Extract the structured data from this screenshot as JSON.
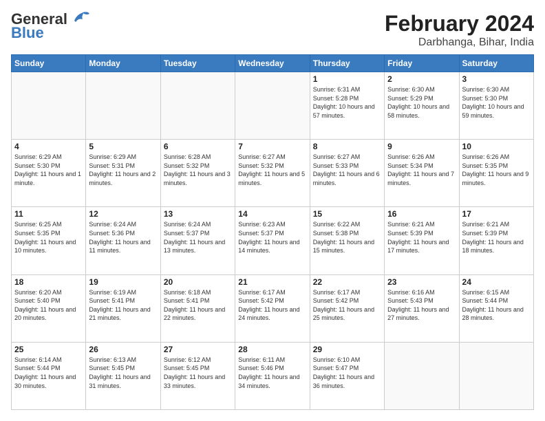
{
  "header": {
    "logo_line1": "General",
    "logo_line2": "Blue",
    "title": "February 2024",
    "subtitle": "Darbhanga, Bihar, India"
  },
  "weekdays": [
    "Sunday",
    "Monday",
    "Tuesday",
    "Wednesday",
    "Thursday",
    "Friday",
    "Saturday"
  ],
  "weeks": [
    [
      {
        "day": "",
        "info": ""
      },
      {
        "day": "",
        "info": ""
      },
      {
        "day": "",
        "info": ""
      },
      {
        "day": "",
        "info": ""
      },
      {
        "day": "1",
        "info": "Sunrise: 6:31 AM\nSunset: 5:28 PM\nDaylight: 10 hours and 57 minutes."
      },
      {
        "day": "2",
        "info": "Sunrise: 6:30 AM\nSunset: 5:29 PM\nDaylight: 10 hours and 58 minutes."
      },
      {
        "day": "3",
        "info": "Sunrise: 6:30 AM\nSunset: 5:30 PM\nDaylight: 10 hours and 59 minutes."
      }
    ],
    [
      {
        "day": "4",
        "info": "Sunrise: 6:29 AM\nSunset: 5:30 PM\nDaylight: 11 hours and 1 minute."
      },
      {
        "day": "5",
        "info": "Sunrise: 6:29 AM\nSunset: 5:31 PM\nDaylight: 11 hours and 2 minutes."
      },
      {
        "day": "6",
        "info": "Sunrise: 6:28 AM\nSunset: 5:32 PM\nDaylight: 11 hours and 3 minutes."
      },
      {
        "day": "7",
        "info": "Sunrise: 6:27 AM\nSunset: 5:32 PM\nDaylight: 11 hours and 5 minutes."
      },
      {
        "day": "8",
        "info": "Sunrise: 6:27 AM\nSunset: 5:33 PM\nDaylight: 11 hours and 6 minutes."
      },
      {
        "day": "9",
        "info": "Sunrise: 6:26 AM\nSunset: 5:34 PM\nDaylight: 11 hours and 7 minutes."
      },
      {
        "day": "10",
        "info": "Sunrise: 6:26 AM\nSunset: 5:35 PM\nDaylight: 11 hours and 9 minutes."
      }
    ],
    [
      {
        "day": "11",
        "info": "Sunrise: 6:25 AM\nSunset: 5:35 PM\nDaylight: 11 hours and 10 minutes."
      },
      {
        "day": "12",
        "info": "Sunrise: 6:24 AM\nSunset: 5:36 PM\nDaylight: 11 hours and 11 minutes."
      },
      {
        "day": "13",
        "info": "Sunrise: 6:24 AM\nSunset: 5:37 PM\nDaylight: 11 hours and 13 minutes."
      },
      {
        "day": "14",
        "info": "Sunrise: 6:23 AM\nSunset: 5:37 PM\nDaylight: 11 hours and 14 minutes."
      },
      {
        "day": "15",
        "info": "Sunrise: 6:22 AM\nSunset: 5:38 PM\nDaylight: 11 hours and 15 minutes."
      },
      {
        "day": "16",
        "info": "Sunrise: 6:21 AM\nSunset: 5:39 PM\nDaylight: 11 hours and 17 minutes."
      },
      {
        "day": "17",
        "info": "Sunrise: 6:21 AM\nSunset: 5:39 PM\nDaylight: 11 hours and 18 minutes."
      }
    ],
    [
      {
        "day": "18",
        "info": "Sunrise: 6:20 AM\nSunset: 5:40 PM\nDaylight: 11 hours and 20 minutes."
      },
      {
        "day": "19",
        "info": "Sunrise: 6:19 AM\nSunset: 5:41 PM\nDaylight: 11 hours and 21 minutes."
      },
      {
        "day": "20",
        "info": "Sunrise: 6:18 AM\nSunset: 5:41 PM\nDaylight: 11 hours and 22 minutes."
      },
      {
        "day": "21",
        "info": "Sunrise: 6:17 AM\nSunset: 5:42 PM\nDaylight: 11 hours and 24 minutes."
      },
      {
        "day": "22",
        "info": "Sunrise: 6:17 AM\nSunset: 5:42 PM\nDaylight: 11 hours and 25 minutes."
      },
      {
        "day": "23",
        "info": "Sunrise: 6:16 AM\nSunset: 5:43 PM\nDaylight: 11 hours and 27 minutes."
      },
      {
        "day": "24",
        "info": "Sunrise: 6:15 AM\nSunset: 5:44 PM\nDaylight: 11 hours and 28 minutes."
      }
    ],
    [
      {
        "day": "25",
        "info": "Sunrise: 6:14 AM\nSunset: 5:44 PM\nDaylight: 11 hours and 30 minutes."
      },
      {
        "day": "26",
        "info": "Sunrise: 6:13 AM\nSunset: 5:45 PM\nDaylight: 11 hours and 31 minutes."
      },
      {
        "day": "27",
        "info": "Sunrise: 6:12 AM\nSunset: 5:45 PM\nDaylight: 11 hours and 33 minutes."
      },
      {
        "day": "28",
        "info": "Sunrise: 6:11 AM\nSunset: 5:46 PM\nDaylight: 11 hours and 34 minutes."
      },
      {
        "day": "29",
        "info": "Sunrise: 6:10 AM\nSunset: 5:47 PM\nDaylight: 11 hours and 36 minutes."
      },
      {
        "day": "",
        "info": ""
      },
      {
        "day": "",
        "info": ""
      }
    ]
  ]
}
